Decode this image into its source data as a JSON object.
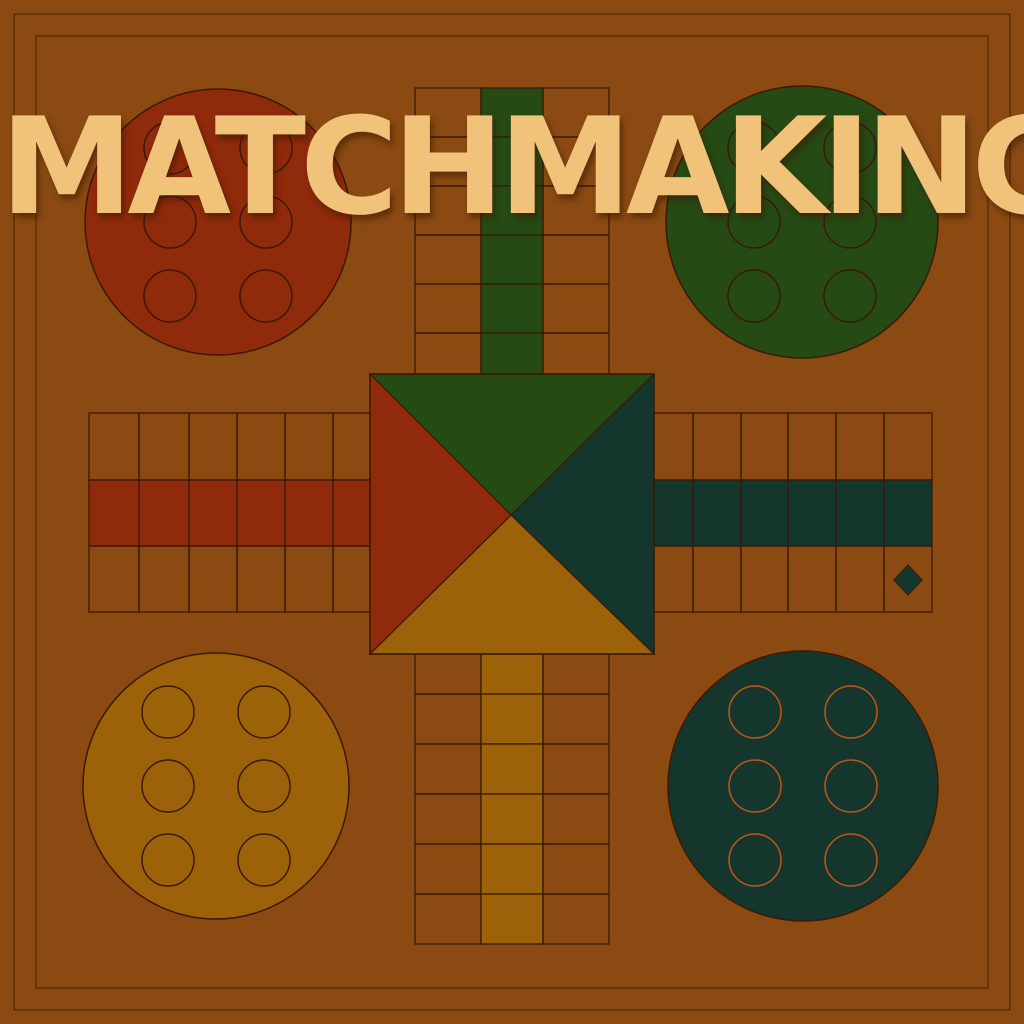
{
  "title": "MATCHMAKING",
  "colors": {
    "background": "#8a4a12",
    "line": "#3a1a06",
    "red": "#8f2a0a",
    "green": "#254a14",
    "teal": "#15362c",
    "yellow": "#9c6209",
    "title": "#f0c27a",
    "teal_slot_ring": "#c4551a"
  },
  "bases": [
    {
      "name": "red-base",
      "color": "red",
      "slots": 6
    },
    {
      "name": "green-base",
      "color": "green",
      "slots": 6
    },
    {
      "name": "yellow-base",
      "color": "yellow",
      "slots": 6
    },
    {
      "name": "teal-base",
      "color": "teal",
      "slots": 6
    }
  ],
  "home_triangles": [
    "green",
    "teal",
    "yellow",
    "red"
  ],
  "home_lanes": [
    "red",
    "green",
    "teal",
    "yellow"
  ],
  "markers": [
    {
      "name": "diamond-marker",
      "shape": "diamond",
      "arm": "right"
    }
  ]
}
